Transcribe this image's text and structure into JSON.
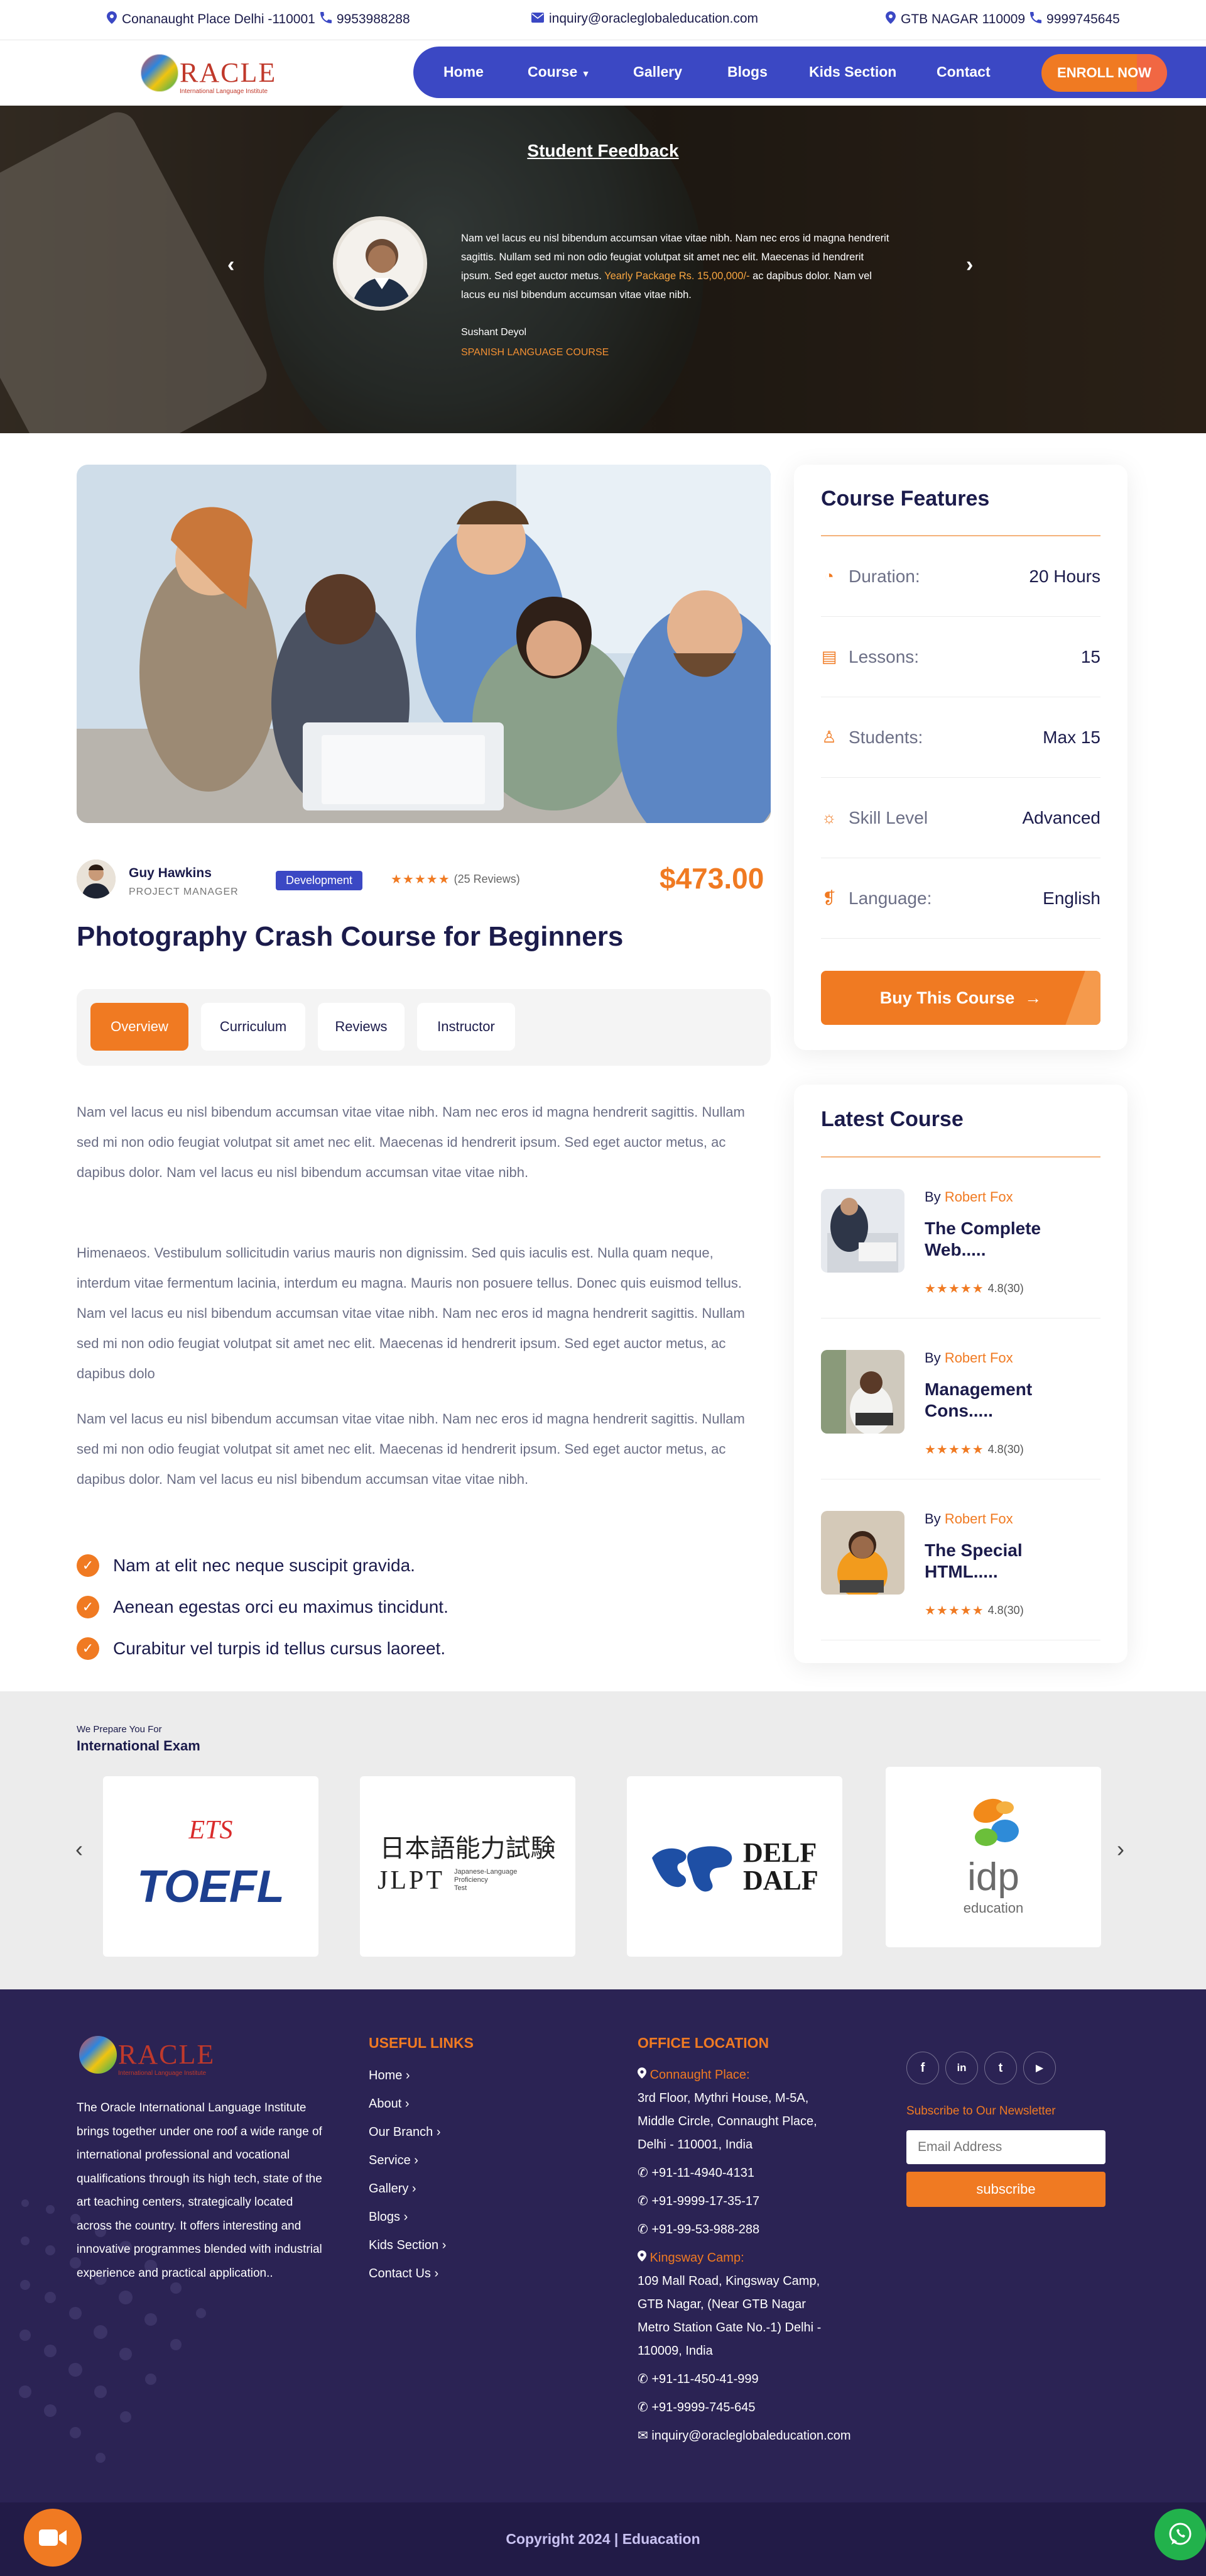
{
  "topbar": {
    "addr1": "Conanaught Place Delhi -110001",
    "phone1": "9953988288",
    "email": "inquiry@oracleglobaleducation.com",
    "addr2": "GTB NAGAR 110009",
    "phone2": "9999745645"
  },
  "brand": {
    "logo_text": "RACLE",
    "logo_sub": "International Language Institute"
  },
  "nav": {
    "items": [
      "Home",
      "Course",
      "Gallery",
      "Blogs",
      "Kids Section",
      "Contact"
    ],
    "enroll": "ENROLL NOW"
  },
  "hero": {
    "title": "Student Feedback",
    "quote_a": "Nam vel lacus eu nisl bibendum accumsan vitae vitae nibh. Nam nec eros id magna hendrerit sagittis. Nullam sed mi non odio feugiat volutpat sit amet nec elit. Maecenas id hendrerit ipsum. Sed eget auctor metus. ",
    "quote_highlight": "Yearly Package Rs. 15,00,000/-",
    "quote_b": " ac dapibus dolor. Nam vel lacus eu nisl bibendum accumsan vitae vitae nibh.",
    "name": "Sushant Deyol",
    "course": "SPANISH LANGUAGE COURSE"
  },
  "course": {
    "instructor_name": "Guy Hawkins",
    "instructor_role": "PROJECT MANAGER",
    "category": "Development",
    "stars": "★★★★★",
    "reviews": "(25 Reviews)",
    "price": "$473.00",
    "title": "Photography Crash Course for Beginners",
    "tabs": [
      "Overview",
      "Curriculum",
      "Reviews",
      "Instructor"
    ],
    "paragraphs": [
      "Nam vel lacus eu nisl bibendum accumsan vitae vitae nibh. Nam nec eros id magna hendrerit sagittis. Nullam sed mi non odio feugiat volutpat sit amet nec elit. Maecenas id hendrerit ipsum. Sed eget auctor metus, ac dapibus dolor. Nam vel lacus eu nisl bibendum accumsan vitae vitae nibh.",
      "Himenaeos. Vestibulum sollicitudin varius mauris non dignissim. Sed quis iaculis est. Nulla quam neque, interdum vitae fermentum lacinia, interdum eu magna. Mauris non posuere tellus. Donec quis euismod tellus. Nam vel lacus eu nisl bibendum accumsan vitae vitae nibh. Nam nec eros id magna hendrerit sagittis. Nullam sed mi non odio feugiat volutpat sit amet nec elit. Maecenas id hendrerit ipsum. Sed eget auctor metus, ac dapibus dolo",
      "Nam vel lacus eu nisl bibendum accumsan vitae vitae nibh. Nam nec eros id magna hendrerit sagittis. Nullam sed mi non odio feugiat volutpat sit amet nec elit. Maecenas id hendrerit ipsum. Sed eget auctor metus, ac dapibus dolor. Nam vel lacus eu nisl bibendum accumsan vitae vitae nibh."
    ],
    "checks": [
      "Nam at elit nec neque suscipit gravida.",
      "Aenean egestas orci eu maximus tincidunt.",
      "Curabitur vel turpis id tellus cursus laoreet."
    ]
  },
  "features": {
    "title": "Course Features",
    "rows": [
      {
        "icon": "clock-icon",
        "label": "Duration:",
        "value": "20 Hours"
      },
      {
        "icon": "book-icon",
        "label": "Lessons:",
        "value": "15"
      },
      {
        "icon": "user-icon",
        "label": "Students:",
        "value": "Max 15"
      },
      {
        "icon": "bulb-icon",
        "label": "Skill Level",
        "value": "Advanced"
      },
      {
        "icon": "language-icon",
        "label": "Language:",
        "value": "English"
      }
    ],
    "buy": "Buy This Course"
  },
  "latest": {
    "title": "Latest Course",
    "by": "By",
    "items": [
      {
        "author": "Robert Fox",
        "title": "The Complete Web.....",
        "rating": "4.8(30)"
      },
      {
        "author": "Robert Fox",
        "title": "Management Cons.....",
        "rating": "4.8(30)"
      },
      {
        "author": "Robert Fox",
        "title": "The Special HTML.....",
        "rating": "4.8(30)"
      }
    ]
  },
  "exams": {
    "small": "We Prepare You For",
    "title": "International Exam",
    "logos": {
      "toefl_top": "ETS",
      "toefl": "TOEFL",
      "jlpt_kanji": "日本語能力試験",
      "jlpt": "JLPT",
      "jlpt_sub1": "Japanese-Language",
      "jlpt_sub2": "Proficiency",
      "jlpt_sub3": "Test",
      "delf1": "DELF",
      "delf2": "DALF",
      "idp": "idp",
      "idp_sub": "education"
    }
  },
  "footer": {
    "about": "The Oracle International Language Institute brings together under one roof a wide range of international professional and vocational qualifications through its high tech, state of the art teaching centers, strategically located across the country. It offers interesting and innovative programmes blended with industrial experience and practical application..",
    "links_title": "USEFUL LINKS",
    "links": [
      "Home ›",
      "About ›",
      "Our Branch ›",
      "Service ›",
      "Gallery ›",
      "Blogs ›",
      "Kids Section ›",
      "Contact Us ›"
    ],
    "office_title": "OFFICE LOCATION",
    "office1_name": "Connaught Place:",
    "office1_addr1": "3rd Floor, Mythri House, M-5A,",
    "office1_addr2": "Middle Circle, Connaught Place,",
    "office1_addr3": "Delhi - 110001, India",
    "phones1": [
      "+91-11-4940-4131",
      "+91-9999-17-35-17",
      "+91-99-53-988-288"
    ],
    "office2_name": "Kingsway Camp:",
    "office2_addr1": "109 Mall Road, Kingsway Camp,",
    "office2_addr2": "GTB Nagar, (Near GTB Nagar",
    "office2_addr3": "Metro Station Gate No.-1) Delhi -",
    "office2_addr4": "110009, India",
    "phones2": [
      "+91-11-450-41-999",
      "+91-9999-745-645"
    ],
    "mail": "inquiry@oracleglobaleducation.com",
    "social": [
      "f",
      "in",
      "t",
      "▶"
    ],
    "subscribe_text": "Subscribe to Our Newsletter",
    "email_placeholder": "Email Address",
    "subscribe_btn": "subscribe",
    "copyright": "Copyright 2024 | Eduacation"
  }
}
